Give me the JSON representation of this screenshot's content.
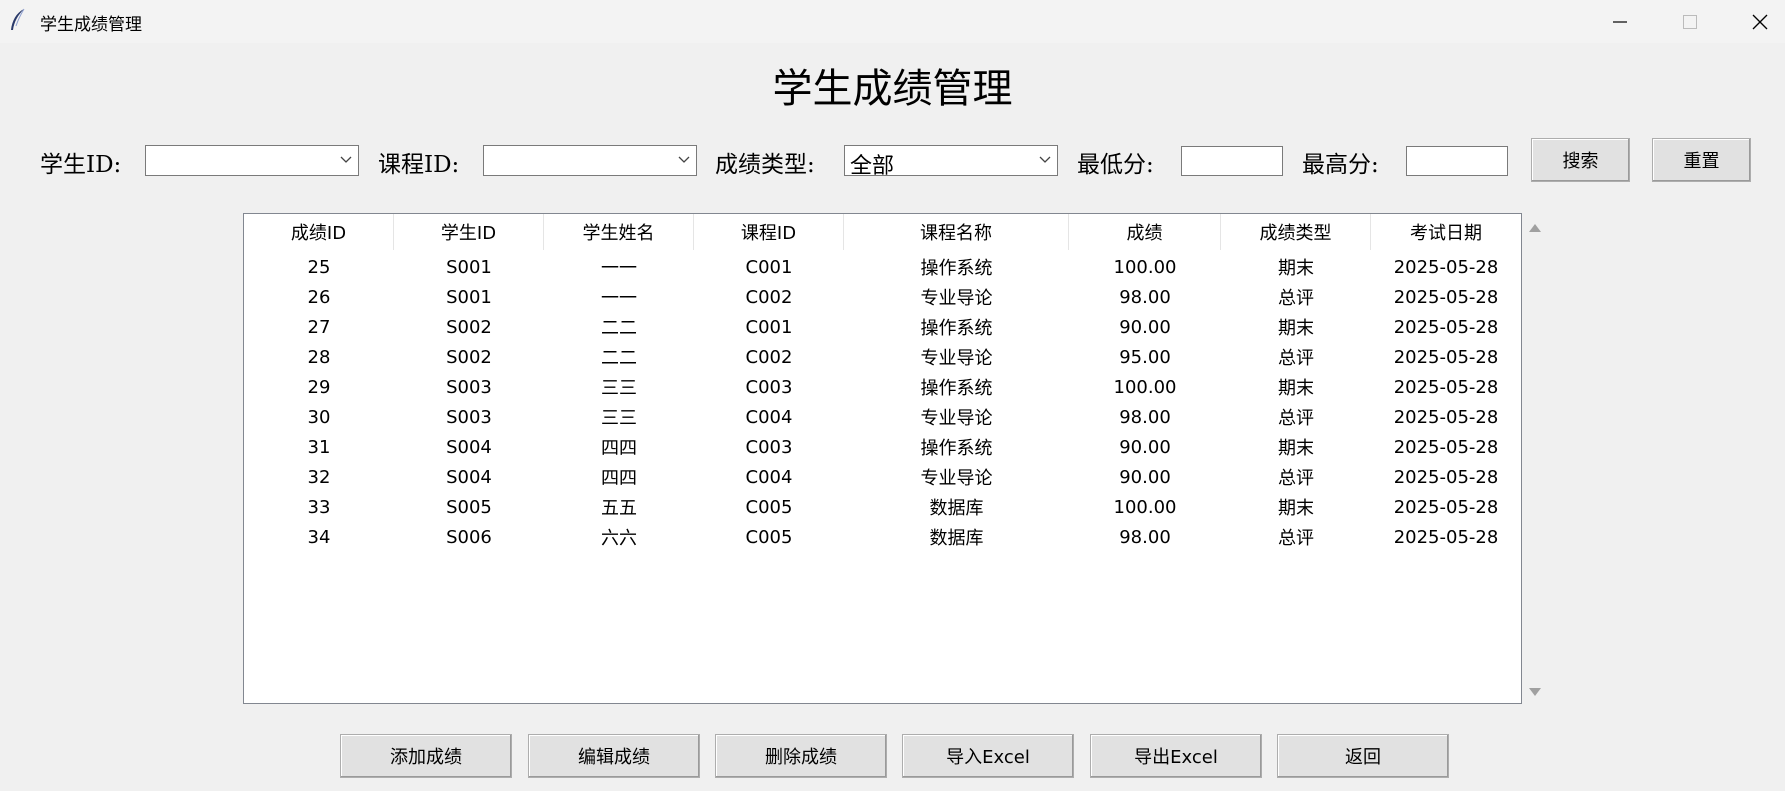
{
  "window": {
    "title": "学生成绩管理",
    "icon": "feather-icon"
  },
  "page": {
    "title": "学生成绩管理"
  },
  "filters": {
    "student_id_label": "学生ID:",
    "student_id_value": "",
    "course_id_label": "课程ID:",
    "course_id_value": "",
    "grade_type_label": "成绩类型:",
    "grade_type_value": "全部",
    "min_score_label": "最低分:",
    "min_score_value": "",
    "max_score_label": "最高分:",
    "max_score_value": "",
    "search_label": "搜索",
    "reset_label": "重置"
  },
  "table": {
    "columns": [
      "成绩ID",
      "学生ID",
      "学生姓名",
      "课程ID",
      "课程名称",
      "成绩",
      "成绩类型",
      "考试日期"
    ],
    "rows": [
      [
        "25",
        "S001",
        "一一",
        "C001",
        "操作系统",
        "100.00",
        "期末",
        "2025-05-28"
      ],
      [
        "26",
        "S001",
        "一一",
        "C002",
        "专业导论",
        "98.00",
        "总评",
        "2025-05-28"
      ],
      [
        "27",
        "S002",
        "二二",
        "C001",
        "操作系统",
        "90.00",
        "期末",
        "2025-05-28"
      ],
      [
        "28",
        "S002",
        "二二",
        "C002",
        "专业导论",
        "95.00",
        "总评",
        "2025-05-28"
      ],
      [
        "29",
        "S003",
        "三三",
        "C003",
        "操作系统",
        "100.00",
        "期末",
        "2025-05-28"
      ],
      [
        "30",
        "S003",
        "三三",
        "C004",
        "专业导论",
        "98.00",
        "总评",
        "2025-05-28"
      ],
      [
        "31",
        "S004",
        "四四",
        "C003",
        "操作系统",
        "90.00",
        "期末",
        "2025-05-28"
      ],
      [
        "32",
        "S004",
        "四四",
        "C004",
        "专业导论",
        "90.00",
        "总评",
        "2025-05-28"
      ],
      [
        "33",
        "S005",
        "五五",
        "C005",
        "数据库",
        "100.00",
        "期末",
        "2025-05-28"
      ],
      [
        "34",
        "S006",
        "六六",
        "C005",
        "数据库",
        "98.00",
        "总评",
        "2025-05-28"
      ]
    ]
  },
  "actions": {
    "add_label": "添加成绩",
    "edit_label": "编辑成绩",
    "delete_label": "删除成绩",
    "import_label": "导入Excel",
    "export_label": "导出Excel",
    "back_label": "返回"
  }
}
